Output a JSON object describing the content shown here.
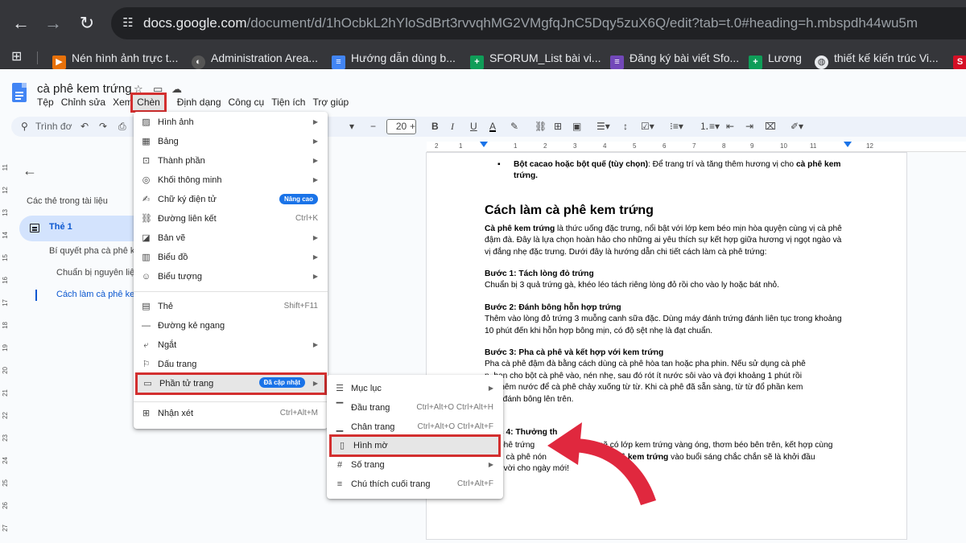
{
  "browser": {
    "url_host": "docs.google.com",
    "url_path": "/document/d/1hOcbkL2hYloSdBrt3rvvqhMG2VMgfqJnC5Dqy5zuX6Q/edit?tab=t.0#heading=h.mbspdh44wu5m",
    "bookmarks": [
      {
        "label": "Nén hình ảnh trực t...",
        "icon": "video-icon",
        "color": "#e8710a"
      },
      {
        "label": "Administration Area...",
        "icon": "globe-dark-icon",
        "color": "#555555"
      },
      {
        "label": "Hướng dẫn dùng b...",
        "icon": "docs-icon",
        "color": "#4285f4"
      },
      {
        "label": "SFORUM_List bài vi...",
        "icon": "sheets-icon",
        "color": "#0f9d58"
      },
      {
        "label": "Đăng ký bài viết Sfo...",
        "icon": "forms-icon",
        "color": "#7248b9"
      },
      {
        "label": "Lương",
        "icon": "sheets-icon",
        "color": "#0f9d58"
      },
      {
        "label": "thiết kế kiến trúc Vi...",
        "icon": "globe-icon",
        "color": "#e8eaed"
      },
      {
        "label": "S",
        "icon": "s-icon",
        "color": "#d50f25"
      }
    ]
  },
  "doc": {
    "title": "cà phê kem trứng",
    "menus": [
      "Tệp",
      "Chỉnh sửa",
      "Xem",
      "Chèn",
      "Định dạng",
      "Công cụ",
      "Tiện ích",
      "Trợ giúp"
    ],
    "search_label": "Trình đơ",
    "font_size": "20"
  },
  "outline": {
    "title": "Các thẻ trong tài liệu",
    "tab": "Thẻ 1",
    "headings": [
      "Bí quyết pha cà phê k",
      "Chuẩn bị nguyên liệ",
      "Cách làm cà phê kem"
    ]
  },
  "page": {
    "bullet_bold": "Bột cacao hoặc bột quế (tùy chọn)",
    "bullet_text": ": Để trang trí và tăng thêm hương vị cho ",
    "bullet_bold2": "cà phê kem trứng.",
    "heading": "Cách làm cà phê kem trứng",
    "intro_bold": "Cà phê kem trứng",
    "intro": " là thức uống đặc trưng, nổi bật với lớp kem béo mịn hòa quyện cùng vị cà phê đậm đà. Đây là lựa chọn hoàn hảo cho những ai yêu thích sự kết hợp giữa hương vị ngọt ngào và vị đắng nhẹ đặc trưng. Dưới đây là hướng dẫn chi tiết cách làm cà phê trứng:",
    "step1_title": "Bước 1: Tách lòng đỏ trứng",
    "step1": "Chuẩn bị 3 quả trứng gà, khéo léo tách riêng lòng đỏ rồi cho vào ly hoặc bát nhỏ.",
    "step2_title": "Bước 2: Đánh bông hỗn hợp trứng",
    "step2": "Thêm vào lòng đỏ trứng 3 muỗng canh sữa đặc. Dùng máy đánh trứng đánh liên tục trong khoảng 10 phút đến khi hỗn hợp bông mịn, có độ sệt nhẹ là đạt chuẩn.",
    "step3_title": "Bước 3: Pha cà phê và kết hợp với kem trứng",
    "step3_l1": "Pha cà phê đậm đà bằng cách dùng cà phê hòa tan hoặc pha phin. Nếu sử dụng cà phê",
    "step3_l2": "n, bạn cho bột cà phê vào, nén nhẹ, sau đó rót ít nước sôi vào và đợi khoảng 1 phút rồi",
    "step3_l3": "tục thêm nước để cà phê chảy xuống từ từ. Khi cà phê đã sẵn sàng, từ từ đổ phần kem",
    "step3_l4": "g đã đánh bông lên trên.",
    "step4_title": "c 4: Thưởng th",
    "step4_l1a": "phê trứng",
    "step4_l1b": "sẽ có lớp kem trứng vàng óng, thơm béo bên trên, kết hợp cùng",
    "step4_l2a": "g cà phê nón",
    "step4_l2b": "phê kem trứng",
    "step4_l2c": " vào buổi sáng chắc chắn sẽ là khởi đầu",
    "step4_l3": "t vời cho ngày mới!"
  },
  "insert_menu": {
    "items": [
      {
        "label": "Hình ảnh",
        "icon": "image-icon",
        "arrow": true
      },
      {
        "label": "Bảng",
        "icon": "table-icon",
        "arrow": true
      },
      {
        "label": "Thành phần",
        "icon": "building-blocks-icon",
        "arrow": true
      },
      {
        "label": "Khối thông minh",
        "icon": "smart-chip-icon",
        "arrow": true
      },
      {
        "label": "Chữ ký điện tử",
        "icon": "signature-icon",
        "badge": "Nâng cao"
      },
      {
        "label": "Đường liên kết",
        "icon": "link-icon",
        "shortcut": "Ctrl+K"
      },
      {
        "label": "Bản vẽ",
        "icon": "drawing-icon",
        "arrow": true
      },
      {
        "label": "Biểu đồ",
        "icon": "chart-icon",
        "arrow": true
      },
      {
        "label": "Biểu tượng",
        "icon": "emoji-icon",
        "arrow": true
      },
      {
        "label": "Thẻ",
        "icon": "tab-icon",
        "shortcut": "Shift+F11"
      },
      {
        "label": "Đường kẻ ngang",
        "icon": "horizontal-line-icon"
      },
      {
        "label": "Ngắt",
        "icon": "break-icon",
        "arrow": true
      },
      {
        "label": "Dấu trang",
        "icon": "bookmark-icon"
      },
      {
        "label": "Phần tử trang",
        "icon": "page-elements-icon",
        "badge": "Đã cập nhật",
        "arrow": true
      },
      {
        "label": "Nhận xét",
        "icon": "comment-icon",
        "shortcut": "Ctrl+Alt+M"
      }
    ]
  },
  "page_elements_submenu": {
    "items": [
      {
        "label": "Mục lục",
        "icon": "toc-icon",
        "arrow": true
      },
      {
        "label": "Đầu trang",
        "icon": "header-icon",
        "shortcut": "Ctrl+Alt+O Ctrl+Alt+H"
      },
      {
        "label": "Chân trang",
        "icon": "footer-icon",
        "shortcut": "Ctrl+Alt+O Ctrl+Alt+F"
      },
      {
        "label": "Hình mờ",
        "icon": "watermark-icon"
      },
      {
        "label": "Số trang",
        "icon": "page-number-icon",
        "arrow": true
      },
      {
        "label": "Chú thích cuối trang",
        "icon": "footnote-icon",
        "shortcut": "Ctrl+Alt+F"
      }
    ]
  },
  "ruler_ticks": [
    "2",
    "1",
    "1",
    "2",
    "3",
    "4",
    "5",
    "6",
    "7",
    "8",
    "9",
    "10",
    "11",
    "12"
  ],
  "vruler_ticks": [
    "11",
    "12",
    "13",
    "14",
    "15",
    "16",
    "17",
    "18",
    "19",
    "20",
    "21",
    "22",
    "23",
    "24",
    "25",
    "26",
    "27"
  ],
  "colors": {
    "highlight_border": "#d32f2f",
    "accent": "#1a73e8",
    "arrow": "#e0283e"
  }
}
